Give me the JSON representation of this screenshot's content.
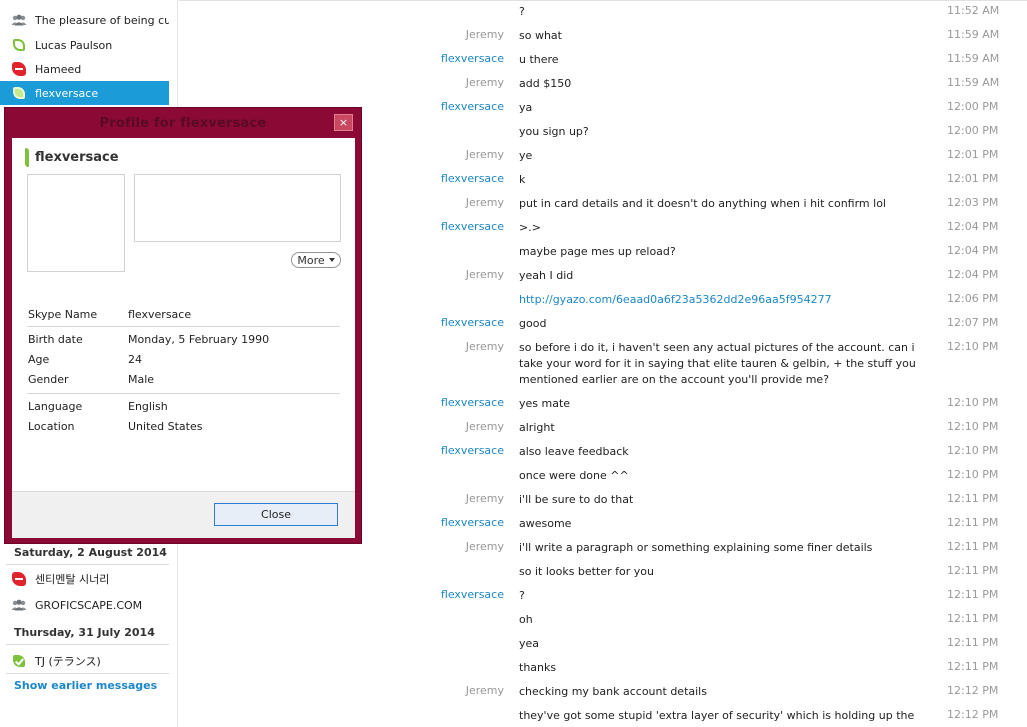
{
  "sidebar": {
    "contacts_top": [
      {
        "name": "The pleasure of being cu...",
        "icon": "group-icon"
      },
      {
        "name": "Lucas Paulson",
        "icon": "online-icon"
      },
      {
        "name": "Hameed",
        "icon": "busy-icon"
      },
      {
        "name": "flexversace",
        "icon": "online-icon",
        "selected": true
      }
    ],
    "date_sat": "Saturday, 2 August 2014",
    "contacts_sat": [
      {
        "name": "센티멘탈 시너리",
        "icon": "busy-icon"
      },
      {
        "name": "GROFICSCAPE.COM",
        "icon": "group-icon"
      }
    ],
    "date_thu": "Thursday, 31 July 2014",
    "contacts_thu": [
      {
        "name": "TJ (テランス)",
        "icon": "online-check-icon"
      }
    ],
    "show_earlier": "Show earlier messages"
  },
  "profile": {
    "title": "Profile for flexversace",
    "close_x": "×",
    "name": "flexversace",
    "more_label": "More",
    "fields": [
      {
        "k": "Skype Name",
        "v": "flexversace"
      },
      {
        "k": "Birth date",
        "v": "Monday, 5 February 1990"
      },
      {
        "k": "Age",
        "v": "24"
      },
      {
        "k": "Gender",
        "v": "Male"
      },
      {
        "k": "Language",
        "v": "English"
      },
      {
        "k": "Location",
        "v": "United States"
      }
    ],
    "close_label": "Close"
  },
  "chat": {
    "messages": [
      {
        "sender": "",
        "text": "?",
        "time": "11:52 AM"
      },
      {
        "sender": "Jeremy",
        "text": "so what",
        "time": "11:59 AM"
      },
      {
        "sender": "flexversace",
        "text": "u there",
        "time": "11:59 AM"
      },
      {
        "sender": "Jeremy",
        "text": "add $150",
        "time": "11:59 AM"
      },
      {
        "sender": "flexversace",
        "text": "ya",
        "time": "12:00 PM"
      },
      {
        "sender": "",
        "text": "you sign up?",
        "time": "12:00 PM"
      },
      {
        "sender": "Jeremy",
        "text": "ye",
        "time": "12:01 PM"
      },
      {
        "sender": "flexversace",
        "text": "k",
        "time": "12:01 PM"
      },
      {
        "sender": "Jeremy",
        "text": "put in card details and it doesn't do anything when i hit confirm lol",
        "time": "12:03 PM"
      },
      {
        "sender": "flexversace",
        "text": ">.>",
        "time": "12:04 PM"
      },
      {
        "sender": "",
        "text": "maybe page mes up reload?",
        "time": "12:04 PM"
      },
      {
        "sender": "Jeremy",
        "text": "yeah I did",
        "time": "12:04 PM"
      },
      {
        "sender": "",
        "text": "http://gyazo.com/6eaad0a6f23a5362dd2e96aa5f954277",
        "time": "12:06 PM",
        "link": true
      },
      {
        "sender": "flexversace",
        "text": "good",
        "time": "12:07 PM"
      },
      {
        "sender": "Jeremy",
        "text": "so before i do it, i haven't seen any actual pictures of the account. can i take your word for it in saying that elite tauren & gelbin, + the stuff you mentioned earlier are on the account you'll provide me?",
        "time": "12:10 PM"
      },
      {
        "sender": "flexversace",
        "text": "yes mate",
        "time": "12:10 PM"
      },
      {
        "sender": "Jeremy",
        "text": "alright",
        "time": "12:10 PM"
      },
      {
        "sender": "flexversace",
        "text": "also leave feedback",
        "time": "12:10 PM"
      },
      {
        "sender": "",
        "text": "once were done ^^",
        "time": "12:10 PM"
      },
      {
        "sender": "Jeremy",
        "text": "i'll be sure to do that",
        "time": "12:11 PM"
      },
      {
        "sender": "flexversace",
        "text": "awesome",
        "time": "12:11 PM"
      },
      {
        "sender": "Jeremy",
        "text": "i'll write a paragraph or something explaining some finer details",
        "time": "12:11 PM"
      },
      {
        "sender": "",
        "text": "so it looks better for you",
        "time": "12:11 PM"
      },
      {
        "sender": "flexversace",
        "text": "?",
        "time": "12:11 PM"
      },
      {
        "sender": "",
        "text": "oh",
        "time": "12:11 PM"
      },
      {
        "sender": "",
        "text": "yea",
        "time": "12:11 PM"
      },
      {
        "sender": "",
        "text": "thanks",
        "time": "12:11 PM"
      },
      {
        "sender": "Jeremy",
        "text": "checking my bank account details",
        "time": "12:12 PM"
      },
      {
        "sender": "",
        "text": "they've got some stupid 'extra layer of security' which is holding up the transaction to",
        "time": "12:12 PM"
      }
    ]
  },
  "colors": {
    "accent": "#1b9bd7",
    "dialog_frame": "#8b0a35",
    "online": "#7dc13d",
    "busy": "#e0242b",
    "link": "#1b87c9"
  }
}
